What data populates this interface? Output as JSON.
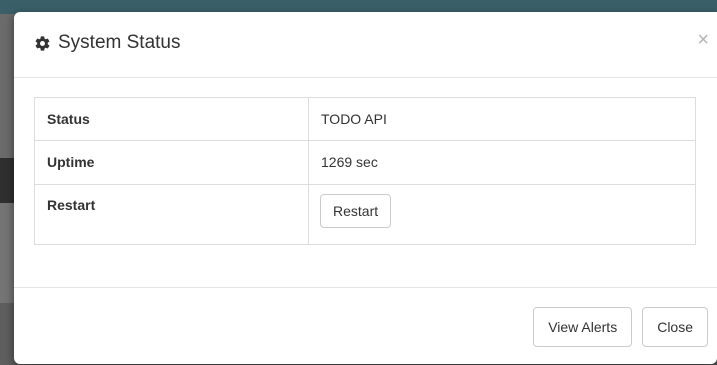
{
  "modal": {
    "title": "System Status",
    "close_label": "×",
    "rows": [
      {
        "label": "Status",
        "value": "TODO API"
      },
      {
        "label": "Uptime",
        "value": "1269 sec"
      },
      {
        "label": "Restart",
        "button_label": "Restart"
      }
    ],
    "footer": {
      "view_alerts_label": "View Alerts",
      "close_label": "Close"
    }
  },
  "icons": {
    "title_icon": "gear-icon",
    "close_icon": "close-icon"
  },
  "colors": {
    "backdrop_top": "#3b5f68",
    "text": "#333333",
    "border": "#dddddd"
  }
}
